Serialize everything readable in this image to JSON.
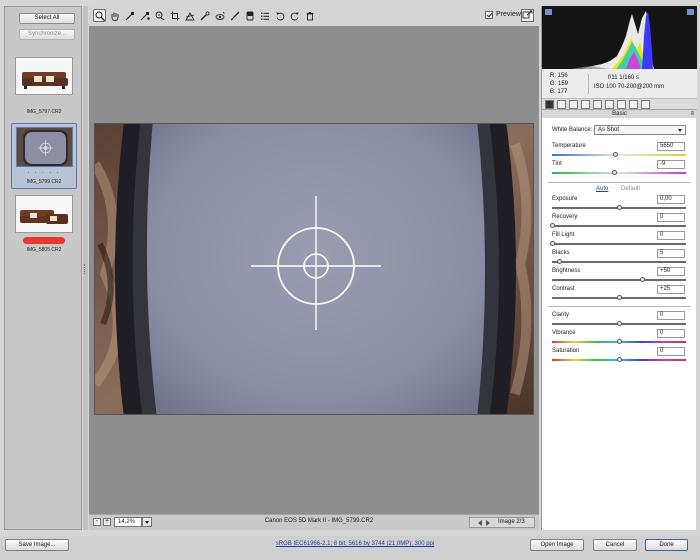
{
  "filmstrip": {
    "select_all": "Select All",
    "synchronize": "Synchronize...",
    "thumbnails": [
      {
        "label": "IMG_5797.CR2"
      },
      {
        "label": "IMG_5799.CR2",
        "rating_dots": ". . . . ."
      },
      {
        "label": "IMG_5805.CR2"
      }
    ]
  },
  "toolbar": {
    "preview_label": "Preview",
    "preview_checked": true
  },
  "statusbar": {
    "zoom_minus": "-",
    "zoom_plus": "+",
    "zoom_value": "14,2%",
    "caption": "Canon EOS 5D Mark II  -  IMG_5799.CR2",
    "image_count": "Image 2/3"
  },
  "info": {
    "r": "R:  156",
    "g": "G:  159",
    "b": "B:  177",
    "aperture_shutter": "f/11    1/160 s",
    "iso_lens": "ISO 100   70-200@200 mm"
  },
  "panel": {
    "section_title": "Basic",
    "white_balance_label": "White Balance:",
    "white_balance_value": "As Shot",
    "auto": "Auto",
    "default": "Default",
    "sliders": {
      "temperature": {
        "label": "Temperature",
        "value": "5650",
        "position": 0.47
      },
      "tint": {
        "label": "Tint",
        "value": "-9",
        "position": 0.46
      },
      "exposure": {
        "label": "Exposure",
        "value": "0,00",
        "position": 0.5
      },
      "recovery": {
        "label": "Recovery",
        "value": "0",
        "position": 0.0
      },
      "fill_light": {
        "label": "Fill Light",
        "value": "0",
        "position": 0.0
      },
      "blacks": {
        "label": "Blacks",
        "value": "5",
        "position": 0.05
      },
      "brightness": {
        "label": "Brightness",
        "value": "+50",
        "position": 0.67
      },
      "contrast": {
        "label": "Contrast",
        "value": "+25",
        "position": 0.5
      },
      "clarity": {
        "label": "Clarity",
        "value": "0",
        "position": 0.5
      },
      "vibrance": {
        "label": "Vibrance",
        "value": "0",
        "position": 0.5
      },
      "saturation": {
        "label": "Saturation",
        "value": "0",
        "position": 0.5
      }
    }
  },
  "bottom": {
    "save_image": "Save Image...",
    "workflow": "sRGB IEC61966-2.1; 8 bit; 5616 by 3744 (21,0MP); 300 ppi",
    "open_image": "Open Image",
    "cancel": "Cancel",
    "done": "Done"
  },
  "icons": [
    "zoom-icon",
    "hand-icon",
    "white-balance-icon",
    "color-sampler-icon",
    "target-adjust-icon",
    "crop-icon",
    "straighten-icon",
    "spot-removal-icon",
    "red-eye-icon",
    "adjustment-brush-icon",
    "graduated-filter-icon",
    "preferences-icon",
    "rotate-left-icon",
    "rotate-right-icon",
    "trash-icon"
  ]
}
